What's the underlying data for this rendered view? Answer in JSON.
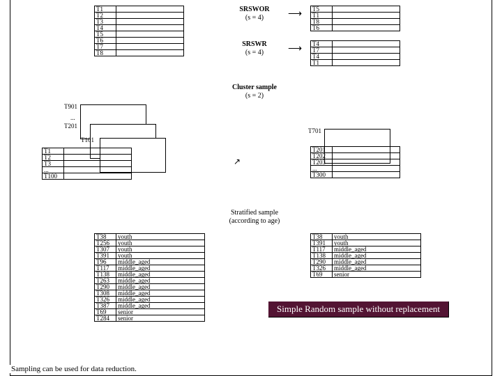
{
  "top": {
    "source": [
      "T1",
      "T2",
      "T3",
      "T4",
      "T5",
      "T6",
      "T7",
      "T8"
    ],
    "srswor": {
      "title": "SRSWOR",
      "sub": "(s = 4)",
      "items": [
        "T5",
        "T1",
        "T8",
        "T6"
      ]
    },
    "srswr": {
      "title": "SRSWR",
      "sub": "(s = 4)",
      "items": [
        "T4",
        "T7",
        "T4",
        "T1"
      ]
    }
  },
  "cluster": {
    "title": "Cluster sample",
    "sub": "(s = 2)",
    "stackLabels": [
      "T901",
      "T201",
      "T101"
    ],
    "leftTbl": [
      "T1",
      "T2",
      "T3",
      "...",
      "T100"
    ],
    "rightStack1": "T701",
    "rightTbl": [
      "T201",
      "T202",
      "T203",
      "...",
      "T300"
    ]
  },
  "stratified": {
    "title": "Stratified sample",
    "sub": "(according to age)",
    "left": [
      {
        "id": "T38",
        "v": "youth"
      },
      {
        "id": "T256",
        "v": "youth"
      },
      {
        "id": "T307",
        "v": "youth"
      },
      {
        "id": "T391",
        "v": "youth"
      },
      {
        "id": "T96",
        "v": "middle_aged"
      },
      {
        "id": "T117",
        "v": "middle_aged"
      },
      {
        "id": "T138",
        "v": "middle_aged"
      },
      {
        "id": "T263",
        "v": "middle_aged"
      },
      {
        "id": "T290",
        "v": "middle_aged"
      },
      {
        "id": "T308",
        "v": "middle_aged"
      },
      {
        "id": "T326",
        "v": "middle_aged"
      },
      {
        "id": "T387",
        "v": "middle_aged"
      },
      {
        "id": "T69",
        "v": "senior"
      },
      {
        "id": "T284",
        "v": "senior"
      }
    ],
    "right": [
      {
        "id": "T38",
        "v": "youth"
      },
      {
        "id": "T391",
        "v": "youth"
      },
      {
        "id": "T117",
        "v": "middle_aged"
      },
      {
        "id": "T138",
        "v": "middle_aged"
      },
      {
        "id": "T290",
        "v": "middle_aged"
      },
      {
        "id": "T326",
        "v": "middle_aged"
      },
      {
        "id": "T69",
        "v": "senior"
      }
    ]
  },
  "highlight": "Simple Random sample without replacement",
  "footer": "Sampling can be used for data reduction."
}
